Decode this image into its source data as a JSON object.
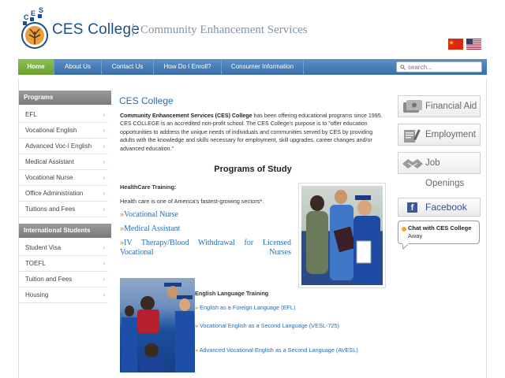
{
  "header": {
    "logo_letters": "CES",
    "logo_name": "CES College",
    "tagline": "Community Enhancement Services",
    "flags": [
      "china-flag-icon",
      "usa-flag-icon"
    ]
  },
  "nav": {
    "items": [
      {
        "label": "Home",
        "active": true
      },
      {
        "label": "About Us"
      },
      {
        "label": "Contact Us"
      },
      {
        "label": "How Do I Enroll?"
      },
      {
        "label": "Consumer Information"
      }
    ],
    "search_placeholder": "search..."
  },
  "sidebar": {
    "programs_heading": "Programs",
    "programs": [
      "EFL",
      "Vocational English",
      "Advanced Voc-l English",
      "Medical Assistant",
      "Vocational Nurse",
      "Office Administration",
      "Tuitions and Fees"
    ],
    "intl_heading": "International Students",
    "intl": [
      "Student Visa",
      "TOEFL",
      "Tuition and Fees",
      "Housing"
    ],
    "chevron": "›"
  },
  "main": {
    "title": "CES College",
    "intro_bold": "Community Enhancement Services (CES) College",
    "intro_rest": " has been offering educational programs since 1995. CES COLLEGE is an accredited non-profit school. The CES College's purpose is to \"offer education opportunities to address the unique needs of individuals and communities served by CES by providing adults with the knowledge and skills necessary for employment, skill upgrades, career changes and/or advanced education.\"",
    "programs_title": "Programs of Study",
    "healthcare_heading": "HealthCare Training:",
    "healthcare_desc": "Health care is one of America's fastest-growing sectors*.",
    "healthcare_links": [
      "Vocational Nurse",
      "Medical Assistant",
      "IV Therapy/Blood Withdrawal for Licensed Vocational Nurses"
    ],
    "arrow": "»",
    "english_heading": "English Language Training",
    "english_links": [
      "English as a Foreign Language (EFL)",
      "Vocational English as a Second Language (VESL-725)",
      "Advanced Vocational English as a Second Language (AVESL)"
    ]
  },
  "right": {
    "buttons": [
      {
        "label": "Financial Aid",
        "icon": "financial-aid-icon"
      },
      {
        "label": "Employment",
        "icon": "employment-icon"
      },
      {
        "label": "Job Openings",
        "icon": "handshake-icon"
      }
    ],
    "facebook_label": "Facebook",
    "facebook_glyph": "f",
    "chat_title": "Chat with CES College",
    "chat_status": "Away"
  },
  "colors": {
    "nav_blue": "#3a6ea8",
    "nav_active": "#6aa02e",
    "link_blue": "#2a6bb0",
    "arrow_gold": "#d79a1c",
    "sidebar_head": "#8a8a8a"
  }
}
